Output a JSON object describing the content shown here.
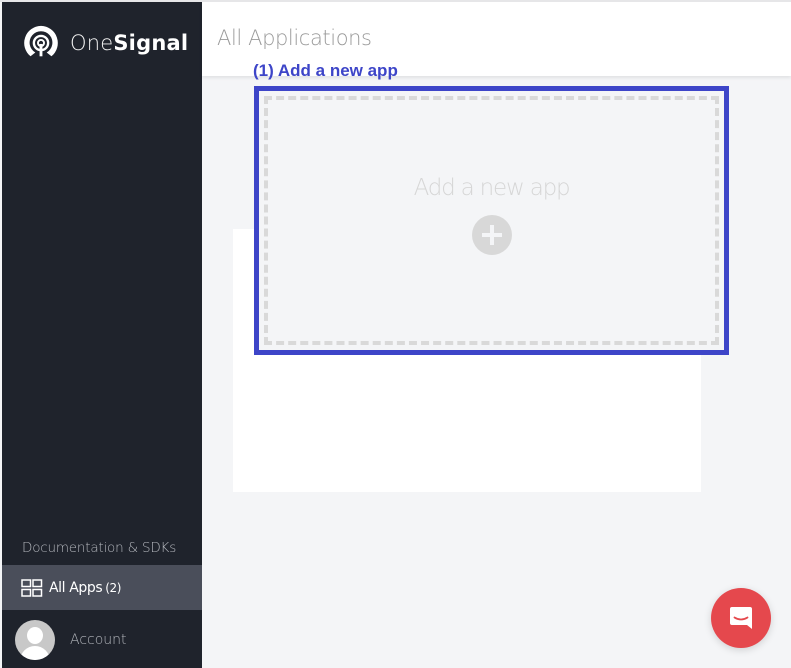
{
  "brand": {
    "name_light": "One",
    "name_bold": "Signal",
    "logo_icon": "onesignal-logo-icon"
  },
  "header": {
    "title": "All Applications"
  },
  "annotation": {
    "label": "(1) Add a new app",
    "color": "#3d45c8"
  },
  "add_app_card": {
    "label": "Add a new app",
    "icon": "plus-circle-icon"
  },
  "sidebar": {
    "docs_link": "Documentation & SDKs",
    "all_apps": {
      "label": "All Apps",
      "count": "(2)",
      "icon": "grid-icon"
    },
    "account": {
      "label": "Account",
      "icon": "avatar"
    }
  },
  "chat": {
    "icon": "chat-icon",
    "color": "#e5484d"
  }
}
